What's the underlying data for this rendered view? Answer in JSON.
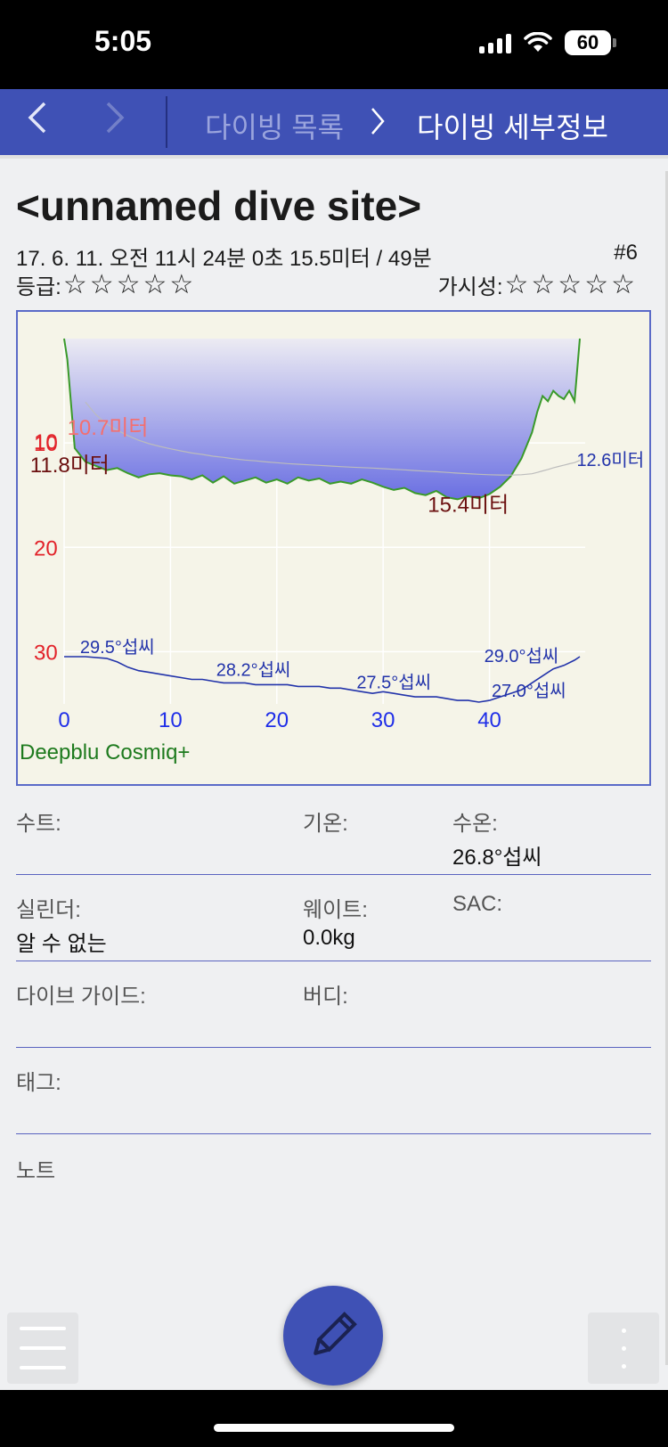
{
  "status_bar": {
    "time": "5:05",
    "battery": "60"
  },
  "nav": {
    "back_icon": "chevron-left-icon",
    "forward_icon": "chevron-right-icon",
    "crumb_list": "다이빙 목록",
    "crumb_separator": ">",
    "crumb_detail": "다이빙 세부정보"
  },
  "dive": {
    "site_name": "<unnamed dive site>",
    "info": "17. 6. 11. 오전 11시 24분 0초  15.5미터 / 49분",
    "number": "#6",
    "rating_label": "등급:",
    "rating_stars": "☆☆☆☆☆",
    "rating_value": 0,
    "visibility_label": "가시성:",
    "visibility_stars": "☆☆☆☆☆",
    "visibility_value": 0
  },
  "chart_data": {
    "type": "area",
    "xlabel": "",
    "ylabel": "",
    "xlim": [
      0,
      49
    ],
    "ylim": [
      0,
      35
    ],
    "x_ticks": [
      "0",
      "10",
      "20",
      "30",
      "40"
    ],
    "y_ticks": [
      "10",
      "20",
      "30"
    ],
    "depth_series": {
      "x": [
        0,
        0.3,
        1,
        2,
        3,
        4,
        5,
        6,
        7,
        8,
        9,
        10,
        11,
        12,
        13,
        14,
        15,
        16,
        17,
        18,
        19,
        20,
        21,
        22,
        23,
        24,
        25,
        26,
        27,
        28,
        29,
        30,
        31,
        32,
        33,
        34,
        35,
        36,
        37,
        38,
        39,
        40,
        41,
        42,
        43,
        44,
        44.5,
        45,
        45.5,
        46,
        46.5,
        47,
        47.5,
        48,
        48.5
      ],
      "y": [
        0,
        2,
        10.5,
        11.8,
        12.2,
        12.6,
        12.4,
        12.9,
        13.3,
        13.0,
        12.9,
        13.1,
        13.2,
        13.5,
        13.1,
        13.8,
        13.2,
        13.9,
        13.6,
        13.3,
        13.8,
        13.5,
        13.9,
        13.3,
        13.6,
        13.4,
        13.9,
        13.7,
        13.9,
        13.5,
        13.8,
        14.2,
        14.5,
        14.3,
        14.8,
        15.0,
        14.6,
        15.2,
        15.4,
        15.1,
        15.3,
        14.9,
        14.2,
        13.2,
        11.5,
        9.0,
        7.0,
        5.5,
        6.0,
        5.0,
        5.5,
        5.8,
        5.0,
        6.0,
        0
      ]
    },
    "temperature_series": {
      "x": [
        0,
        2,
        4,
        5,
        6,
        7,
        8,
        9,
        10,
        11,
        12,
        13,
        14,
        15,
        16,
        17,
        18,
        19,
        20,
        21,
        22,
        23,
        24,
        25,
        26,
        27,
        28,
        29,
        30,
        31,
        32,
        33,
        34,
        35,
        36,
        37,
        38,
        39,
        40,
        41,
        42,
        43,
        44,
        45,
        46,
        47,
        48,
        48.5
      ],
      "y": [
        29.5,
        29.5,
        29.4,
        29.2,
        28.9,
        28.7,
        28.6,
        28.5,
        28.4,
        28.3,
        28.2,
        28.2,
        28.1,
        28.0,
        28.0,
        28.0,
        27.9,
        27.9,
        27.9,
        27.9,
        27.8,
        27.8,
        27.8,
        27.7,
        27.7,
        27.6,
        27.5,
        27.4,
        27.5,
        27.4,
        27.3,
        27.2,
        27.2,
        27.2,
        27.1,
        27.0,
        27.0,
        26.9,
        27.0,
        27.2,
        27.4,
        27.6,
        28.0,
        28.4,
        28.8,
        29.0,
        29.3,
        29.5
      ]
    },
    "depth_labels": [
      {
        "text": "10.7미터",
        "x": 0.3,
        "y": 9.2,
        "color": "#f46f6f"
      },
      {
        "text": "11.8미터",
        "x": -3.2,
        "y": 12.8,
        "color": "#6b0f0f"
      },
      {
        "text": "15.4미터",
        "x": 34.2,
        "y": 16.6,
        "color": "#6b0f0f"
      },
      {
        "text": "12.6미터",
        "x": 48.2,
        "y": 12.2,
        "color": "#2233aa"
      }
    ],
    "temperature_labels": [
      {
        "text": "29.5°섭씨",
        "x": 1.5,
        "y": 29.5
      },
      {
        "text": "28.2°섭씨",
        "x": 14.3,
        "y": 28.2
      },
      {
        "text": "27.5°섭씨",
        "x": 27.5,
        "y": 27.5
      },
      {
        "text": "29.0°섭씨",
        "x": 39.5,
        "y": 29.0
      },
      {
        "text": "27.0°섭씨",
        "x": 40.2,
        "y": 27.0
      }
    ],
    "ceiling_label": "10",
    "computer": "Deepblu Cosmiq+",
    "grid": true
  },
  "details": {
    "suit_label": "수트:",
    "suit_value": "",
    "air_temp_label": "기온:",
    "air_temp_value": "",
    "water_temp_label": "수온:",
    "water_temp_value": "26.8°섭씨",
    "cylinder_label": "실린더:",
    "cylinder_value": "알 수 없는",
    "weight_label": "웨이트:",
    "weight_value": "0.0kg",
    "sac_label": "SAC:",
    "sac_value": "",
    "guide_label": "다이브 가이드:",
    "guide_value": "",
    "buddy_label": "버디:",
    "buddy_value": "",
    "tags_label": "태그:",
    "tags_value": "",
    "notes_label": "노트",
    "notes_value": ""
  },
  "toolbar": {
    "menu_icon": "hamburger-menu-icon",
    "edit_icon": "pencil-icon",
    "more_icon": "more-vertical-icon"
  },
  "colors": {
    "accent": "#3f51b5",
    "depth_line": "#3a9a2a",
    "temp_line": "#2233aa",
    "depth_axis": "#e2232a",
    "time_axis": "#1f2ee8"
  }
}
